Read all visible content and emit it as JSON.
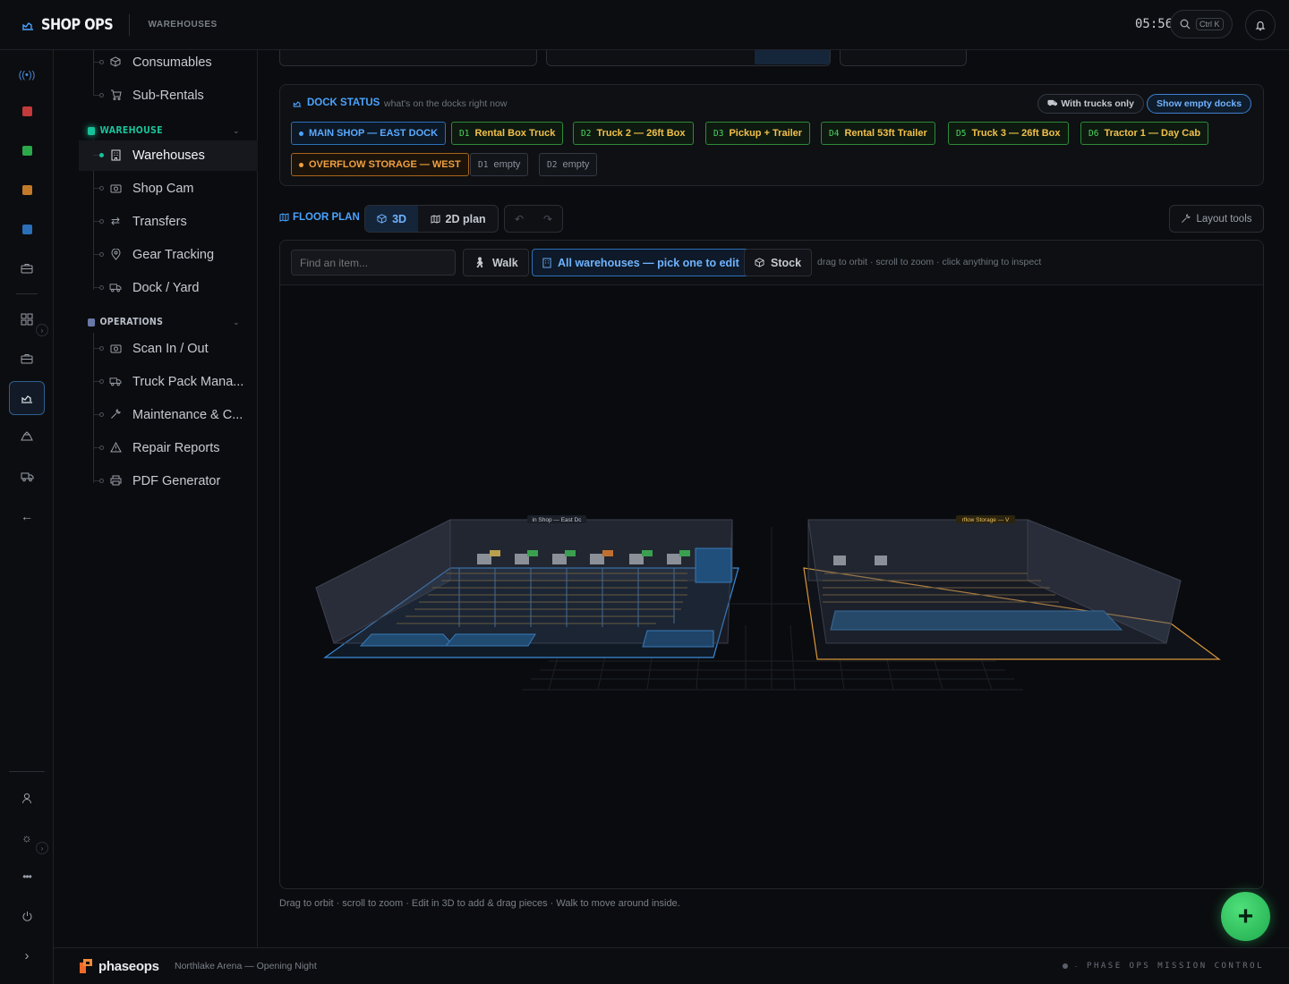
{
  "app": {
    "name": "SHOP OPS",
    "breadcrumb": "WAREHOUSES"
  },
  "topbar": {
    "clock": "05:56",
    "search_shortcut": "Ctrl K"
  },
  "sidebar": {
    "top_items": [
      {
        "label": "Consumables",
        "icon": "box-icon"
      },
      {
        "label": "Sub-Rentals",
        "icon": "cart-icon"
      }
    ],
    "sections": [
      {
        "title": "WAREHOUSE",
        "color": "#17c29a",
        "items": [
          {
            "label": "Warehouses",
            "icon": "building-icon",
            "selected": true
          },
          {
            "label": "Shop Cam",
            "icon": "camera-icon"
          },
          {
            "label": "Transfers",
            "icon": "transfer-icon"
          },
          {
            "label": "Gear Tracking",
            "icon": "pin-icon"
          },
          {
            "label": "Dock / Yard",
            "icon": "truck-icon"
          }
        ]
      },
      {
        "title": "OPERATIONS",
        "color": "#6a78a8",
        "items": [
          {
            "label": "Scan In / Out",
            "icon": "scan-icon"
          },
          {
            "label": "Truck Pack Mana...",
            "icon": "truck-icon"
          },
          {
            "label": "Maintenance & C...",
            "icon": "wrench-icon"
          },
          {
            "label": "Repair Reports",
            "icon": "warning-icon"
          },
          {
            "label": "PDF Generator",
            "icon": "printer-icon"
          }
        ]
      }
    ]
  },
  "dock_status": {
    "title": "DOCK STATUS",
    "subtitle": "what's on the docks right now",
    "toggle_trucks": "With trucks only",
    "toggle_empty": "Show empty docks",
    "main_label": "MAIN SHOP — EAST DOCK",
    "main_docks": [
      {
        "code": "D1",
        "label": "Rental Box Truck"
      },
      {
        "code": "D2",
        "label": "Truck 2 — 26ft Box"
      },
      {
        "code": "D3",
        "label": "Pickup + Trailer"
      },
      {
        "code": "D4",
        "label": "Rental 53ft Trailer"
      },
      {
        "code": "D5",
        "label": "Truck 3 — 26ft Box"
      },
      {
        "code": "D6",
        "label": "Tractor 1 — Day Cab"
      }
    ],
    "overflow_label": "OVERFLOW STORAGE — WEST",
    "overflow_docks": [
      {
        "code": "D1",
        "label": "empty"
      },
      {
        "code": "D2",
        "label": "empty"
      }
    ]
  },
  "floor_plan": {
    "title": "FLOOR PLAN",
    "mode_3d": "3D",
    "mode_2d": "2D plan",
    "layout_tools": "Layout tools",
    "search_placeholder": "Find an item...",
    "walk": "Walk",
    "warehouse_select": "All warehouses — pick one to edit",
    "stock": "Stock",
    "hint": "drag to orbit · scroll to zoom · click anything to inspect",
    "label_main": "in Shop — East Dc",
    "label_overflow": "rflow Storage — V",
    "bottom_note": "Drag to orbit · scroll to zoom · Edit in 3D to add & drag pieces · Walk to move around inside."
  },
  "footer": {
    "brand": "phaseops",
    "event": "Northlake Arena — Opening Night",
    "mission": "PHASE OPS MISSION CONTROL"
  },
  "colors": {
    "accent": "#4aa3ff",
    "green": "#17c29a",
    "orange": "#f0a040"
  }
}
